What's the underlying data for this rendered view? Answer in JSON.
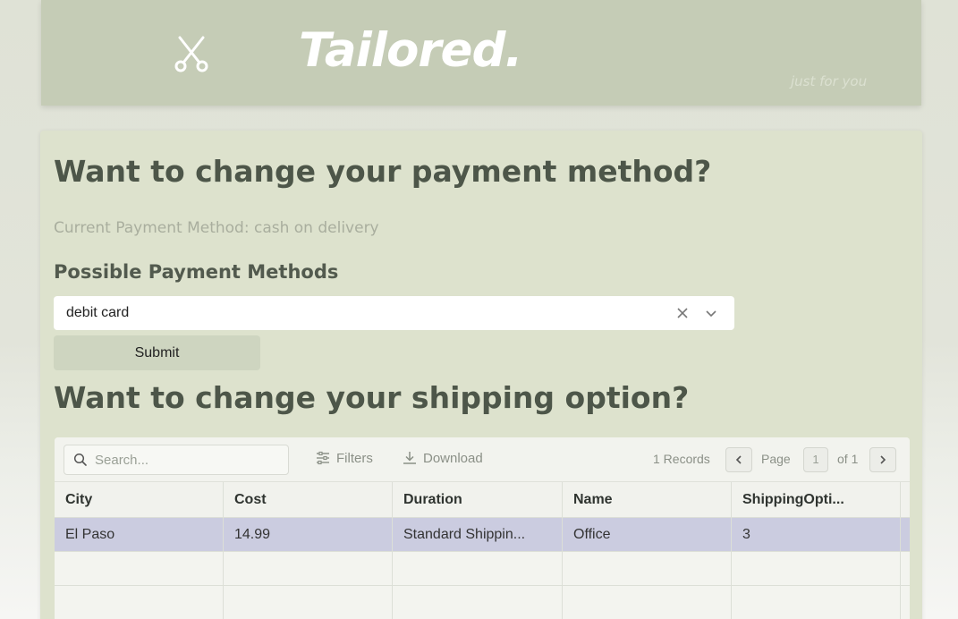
{
  "header": {
    "logo": "Tailored.",
    "tagline": "just for you",
    "icon": "scissors-icon"
  },
  "payment": {
    "heading": "Want to change your payment method?",
    "current": "Current Payment Method: cash on delivery",
    "possible_label": "Possible Payment Methods",
    "selected_value": "debit card",
    "submit_label": "Submit"
  },
  "shipping": {
    "heading": "Want to change your shipping option?",
    "toolbar": {
      "search_placeholder": "Search...",
      "filters_label": "Filters",
      "download_label": "Download",
      "records": "1 Records",
      "page_label": "Page",
      "page_number": "1",
      "page_of": "of 1"
    },
    "columns": [
      "City",
      "Cost",
      "Duration",
      "Name",
      "ShippingOpti..."
    ],
    "rows": [
      [
        "El Paso",
        "14.99",
        "Standard Shippin...",
        "Office",
        "3"
      ]
    ]
  },
  "colors": {
    "header_bg": "#c5ccb6",
    "panel_bg": "#dde2cd",
    "selected_row": "#cbcce0"
  }
}
